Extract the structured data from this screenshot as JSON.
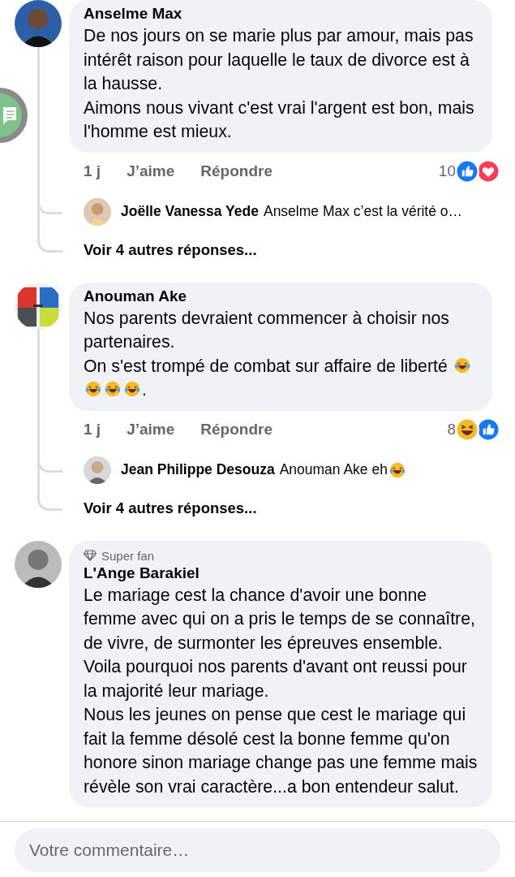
{
  "comments": [
    {
      "author": "Anselme Max",
      "paragraphs": [
        [
          {
            "kind": "text",
            "text": "De nos jours on se marie plus par amour, mais pas intérêt raison pour laquelle le taux de divorce est à la hausse."
          }
        ],
        [
          {
            "kind": "text",
            "text": "Aimons nous vivant c'est vrai l'argent est bon, mais l'homme est mieux."
          }
        ]
      ],
      "time": "1 j",
      "like": "J’aime",
      "reply": "Répondre",
      "reaction_count": "10",
      "reactions": [
        {
          "kind": "like"
        },
        {
          "kind": "love"
        }
      ],
      "replies": [
        {
          "author": "Joëlle Vanessa Yede",
          "segments": [
            {
              "kind": "text",
              "text": "Anselme Max c’est la vérité o…"
            }
          ]
        }
      ],
      "more": "Voir 4 autres réponses..."
    },
    {
      "author": "Anouman Ake",
      "paragraphs": [
        [
          {
            "kind": "text",
            "text": "Nos parents devraient commencer à choisir nos partenaires."
          }
        ],
        [
          {
            "kind": "text",
            "text": "On s'est trompé de combat sur affaire de liberté "
          },
          {
            "kind": "emoji"
          },
          {
            "kind": "emoji"
          },
          {
            "kind": "emoji"
          },
          {
            "kind": "emoji"
          },
          {
            "kind": "text",
            "text": "."
          }
        ]
      ],
      "time": "1 j",
      "like": "J’aime",
      "reply": "Répondre",
      "reaction_count": "8",
      "reactions": [
        {
          "kind": "haha"
        },
        {
          "kind": "like"
        }
      ],
      "replies": [
        {
          "author": "Jean Philippe Desouza",
          "segments": [
            {
              "kind": "text",
              "text": "Anouman Ake eh "
            },
            {
              "kind": "emoji"
            }
          ]
        }
      ],
      "more": "Voir 4 autres réponses..."
    },
    {
      "author": "L'Ange Barakiel",
      "badge": "Super fan",
      "paragraphs": [
        [
          {
            "kind": "text",
            "text": "Le mariage cest la chance d'avoir une bonne femme avec qui on a pris le temps de se connaître, de vivre, de surmonter les épreuves ensemble. Voila pourquoi nos parents d'avant ont reussi pour la majorité leur mariage."
          }
        ],
        [
          {
            "kind": "text",
            "text": "Nous les jeunes on pense que cest le mariage qui fait la femme désolé cest la bonne femme qu'on honore sinon mariage change pas une femme mais révèle son vrai caractère...a bon entendeur salut."
          }
        ]
      ]
    }
  ],
  "composer": {
    "placeholder": "Votre commentaire…"
  }
}
